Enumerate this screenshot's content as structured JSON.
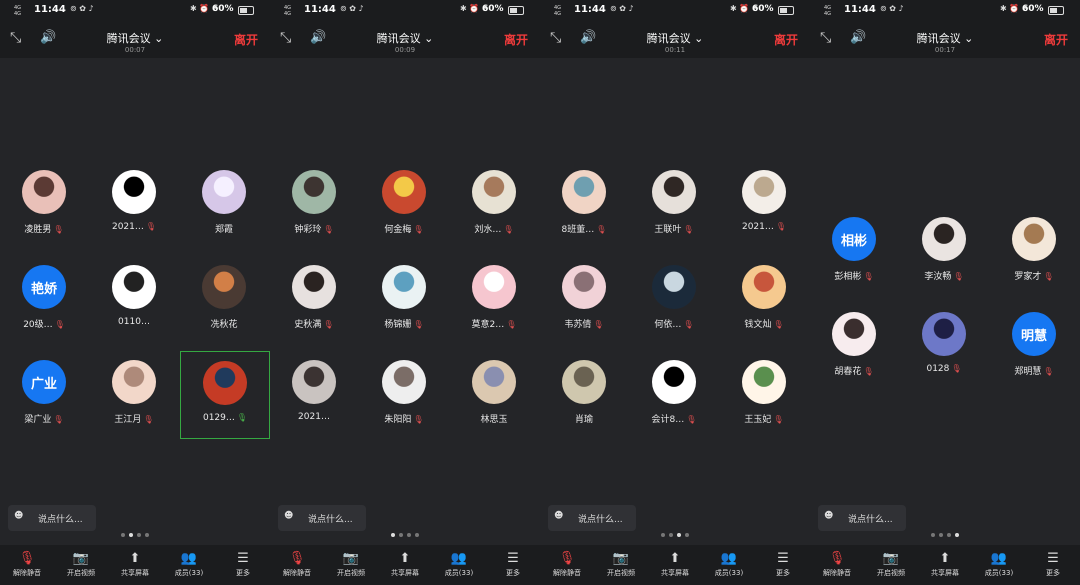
{
  "status": {
    "time": "11:44",
    "battery": "60%"
  },
  "meeting": {
    "title": "腾讯会议",
    "leave_label": "离开",
    "chat_placeholder": "说点什么..."
  },
  "bottom_bar": [
    "解除静音",
    "开启视频",
    "共享屏幕",
    "成员(33)",
    "更多"
  ],
  "panels": [
    {
      "timer": "00:07",
      "page_index": 1,
      "participants": [
        {
          "name": "凌胜男",
          "muted": true,
          "avatar_colors": [
            "#e9c0b8",
            "#5b3a34"
          ]
        },
        {
          "name": "2021…",
          "muted": true,
          "avatar_colors": [
            "#fff",
            "#000"
          ]
        },
        {
          "name": "郑霞",
          "muted": false,
          "avatar_colors": [
            "#d6c7e8",
            "#f5f0ff"
          ]
        },
        {
          "name": "20级…",
          "muted": true,
          "avatar_text": "艳娇"
        },
        {
          "name": "0110…",
          "muted": false,
          "avatar_colors": [
            "#fff",
            "#222"
          ]
        },
        {
          "name": "冼秋花",
          "muted": false,
          "avatar_colors": [
            "#4a3a33",
            "#d27f47"
          ]
        },
        {
          "name": "梁广业",
          "muted": true,
          "avatar_text": "广业"
        },
        {
          "name": "王江月",
          "muted": true,
          "avatar_colors": [
            "#f2d7c9",
            "#ae8a7a"
          ]
        },
        {
          "name": "0129…",
          "muted": false,
          "speaking": true,
          "active": true,
          "avatar_colors": [
            "#c53b25",
            "#203a5c"
          ]
        }
      ]
    },
    {
      "timer": "00:09",
      "page_index": 0,
      "participants": [
        {
          "name": "钟彩玲",
          "muted": true,
          "avatar_colors": [
            "#9fb7a6",
            "#3d3431"
          ]
        },
        {
          "name": "何金梅",
          "muted": true,
          "avatar_colors": [
            "#c9492f",
            "#f3c948"
          ]
        },
        {
          "name": "刘水…",
          "muted": true,
          "avatar_colors": [
            "#e7e1d3",
            "#a67a5c"
          ]
        },
        {
          "name": "史秋满",
          "muted": true,
          "avatar_colors": [
            "#e7e1df",
            "#2a2321"
          ]
        },
        {
          "name": "杨锦姗",
          "muted": true,
          "avatar_colors": [
            "#eaf2f3",
            "#5da0c0"
          ]
        },
        {
          "name": "莫意2…",
          "muted": true,
          "avatar_colors": [
            "#f6c6cf",
            "#fff"
          ]
        },
        {
          "name": "2021…",
          "muted": false,
          "avatar_colors": [
            "#c9c3c0",
            "#3b3332"
          ]
        },
        {
          "name": "朱阳阳",
          "muted": true,
          "avatar_colors": [
            "#eee",
            "#7b6d67"
          ]
        },
        {
          "name": "林思玉",
          "muted": false,
          "avatar_colors": [
            "#dbc8b0",
            "#8a8fb0"
          ]
        }
      ]
    },
    {
      "timer": "00:11",
      "page_index": 2,
      "participants": [
        {
          "name": "8班董…",
          "muted": true,
          "avatar_colors": [
            "#f0d4c5",
            "#6f9fb0"
          ]
        },
        {
          "name": "王联叶",
          "muted": true,
          "avatar_colors": [
            "#e6e0da",
            "#2f2724"
          ]
        },
        {
          "name": "2021…",
          "muted": true,
          "avatar_colors": [
            "#f3eee8",
            "#bca98f"
          ]
        },
        {
          "name": "韦苏倩",
          "muted": true,
          "avatar_colors": [
            "#f1d2d7",
            "#8a7075"
          ]
        },
        {
          "name": "何依…",
          "muted": true,
          "avatar_colors": [
            "#1b2a3a",
            "#c9d7e0"
          ]
        },
        {
          "name": "钱文灿",
          "muted": true,
          "avatar_colors": [
            "#f5c98f",
            "#c7563c"
          ]
        },
        {
          "name": "肖瑜",
          "muted": false,
          "avatar_colors": [
            "#cfc7ae",
            "#6a6252"
          ]
        },
        {
          "name": "会计8…",
          "muted": true,
          "avatar_colors": [
            "#fff",
            "#000"
          ]
        },
        {
          "name": "王玉妃",
          "muted": true,
          "avatar_colors": [
            "#fff5e8",
            "#5a8f4e"
          ]
        }
      ]
    },
    {
      "timer": "00:17",
      "page_index": 3,
      "participants": [
        {
          "name": "彭相彬",
          "muted": true,
          "avatar_text": "相彬"
        },
        {
          "name": "李汝畅",
          "muted": true,
          "avatar_colors": [
            "#eae4e1",
            "#2a2422"
          ]
        },
        {
          "name": "罗家才",
          "muted": true,
          "avatar_colors": [
            "#f3e7d9",
            "#a47a52"
          ]
        },
        {
          "name": "胡春花",
          "muted": true,
          "avatar_colors": [
            "#f7ecee",
            "#3a2e2e"
          ]
        },
        {
          "name": "0128",
          "muted": true,
          "avatar_colors": [
            "#6d78c8",
            "#1e1f45"
          ]
        },
        {
          "name": "郑明慧",
          "muted": true,
          "avatar_text": "明慧"
        }
      ]
    }
  ]
}
